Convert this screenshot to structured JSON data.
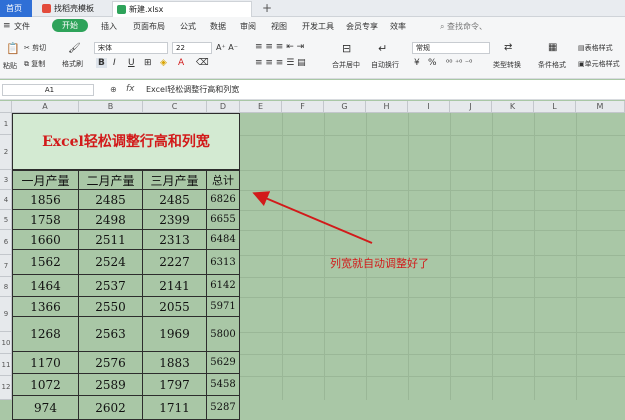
{
  "tabs": {
    "home": "首页",
    "template": "找稻壳模板",
    "file": "新建.xlsx",
    "new_tab": "+"
  },
  "menu": {
    "hamburger": "≡",
    "file": "文件",
    "start": "开始",
    "insert": "插入",
    "layout": "页面布局",
    "formula": "公式",
    "data": "数据",
    "review": "审阅",
    "view": "视图",
    "devtools": "开发工具",
    "vip": "会员专享",
    "efficiency": "效率",
    "search": "查找命令、"
  },
  "ribbon": {
    "cut": "剪切",
    "paste": "粘贴",
    "copy": "复制",
    "format_painter": "格式刷",
    "font": "宋体",
    "font_size": "22",
    "bold": "B",
    "italic": "I",
    "underline": "U",
    "merge": "合并居中",
    "wrap": "自动换行",
    "number_format": "常规",
    "percent": "%",
    "type_convert": "类型转换",
    "cond_format": "条件格式",
    "table_style": "表格样式",
    "cell_style": "单元格样式"
  },
  "formula_bar": {
    "cell_ref": "A1",
    "fx": "fx",
    "content": "Excel轻松调整行高和列宽"
  },
  "columns": [
    "A",
    "B",
    "C",
    "D",
    "E",
    "F",
    "G",
    "H",
    "I",
    "J",
    "K",
    "L",
    "M"
  ],
  "rows": [
    "1",
    "2",
    "3",
    "4",
    "5",
    "6",
    "7",
    "8",
    "9",
    "10",
    "11",
    "12"
  ],
  "sheet": {
    "title": "Excel轻松调整行高和列宽",
    "headers": [
      "一月产量",
      "二月产量",
      "三月产量",
      "总计"
    ],
    "data": [
      [
        "1856",
        "2485",
        "2485",
        "6826"
      ],
      [
        "1758",
        "2498",
        "2399",
        "6655"
      ],
      [
        "1660",
        "2511",
        "2313",
        "6484"
      ],
      [
        "1562",
        "2524",
        "2227",
        "6313"
      ],
      [
        "1464",
        "2537",
        "2141",
        "6142"
      ],
      [
        "1366",
        "2550",
        "2055",
        "5971"
      ],
      [
        "1268",
        "2563",
        "1969",
        "5800"
      ],
      [
        "1170",
        "2576",
        "1883",
        "5629"
      ],
      [
        "1072",
        "2589",
        "1797",
        "5458"
      ],
      [
        "974",
        "2602",
        "1711",
        "5287"
      ]
    ]
  },
  "annotation": "列宽就自动调整好了",
  "colors": {
    "accent": "#2f6fd6",
    "title_red": "#d21a1a",
    "green_start": "#2ea35a",
    "sheet_bg": "#a9c7a6"
  }
}
